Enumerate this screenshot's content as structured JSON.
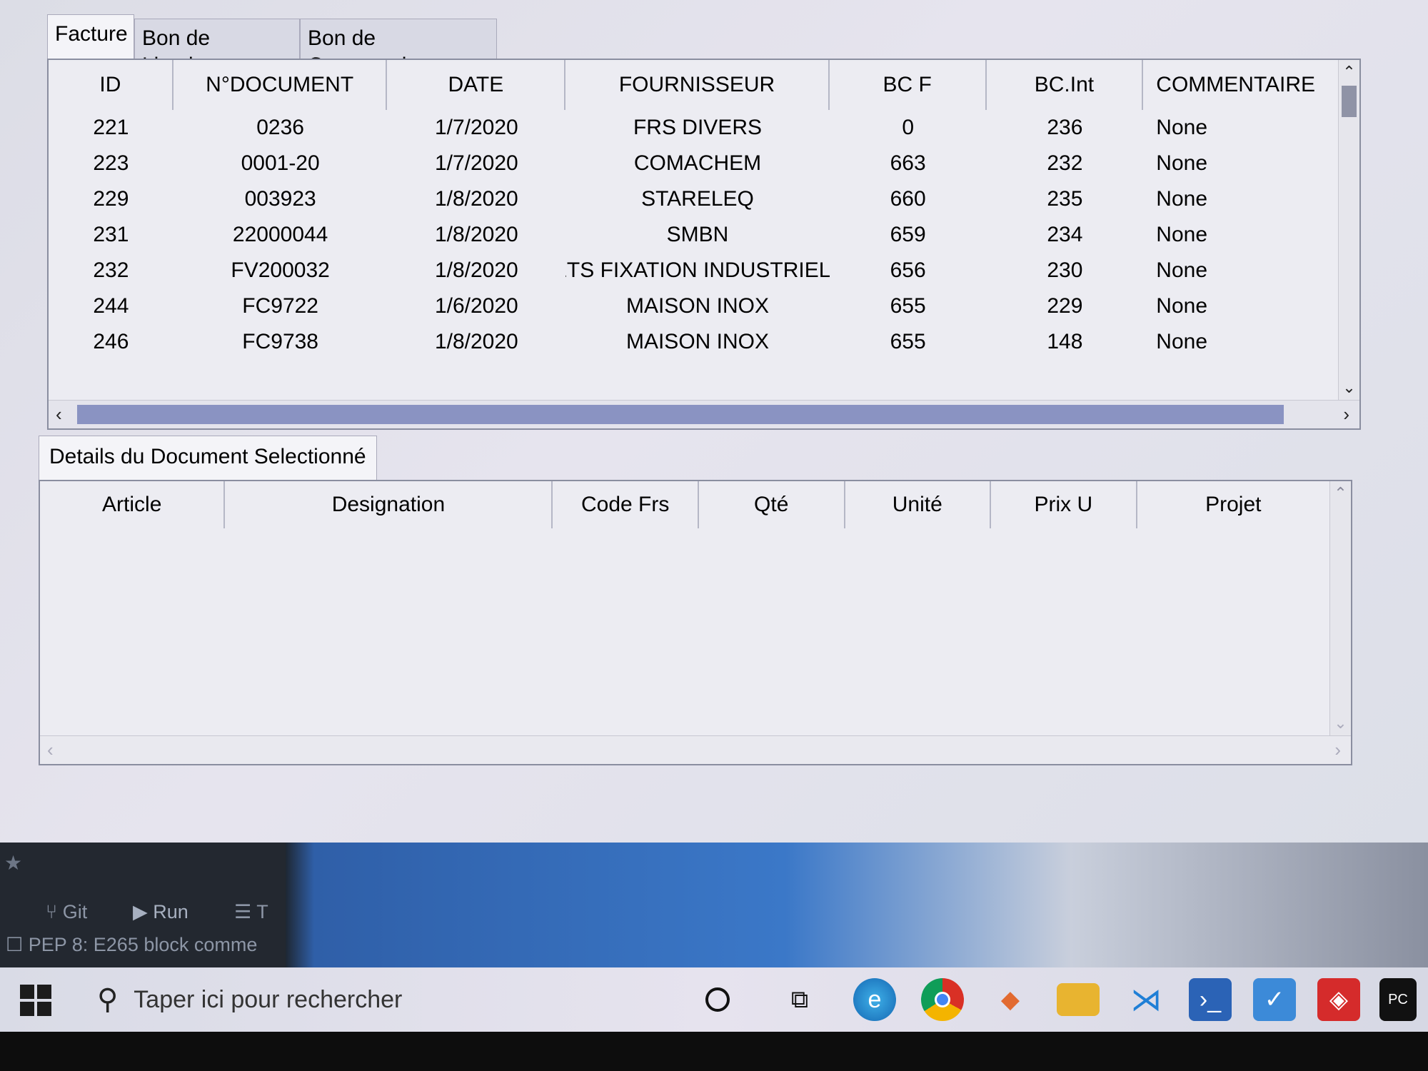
{
  "tabs": [
    "Facture",
    "Bon de Livraison",
    "Bon de Commande"
  ],
  "table": {
    "columns": [
      "ID",
      "N°DOCUMENT",
      "DATE",
      "FOURNISSEUR",
      "BC F",
      "BC.Int",
      "COMMENTAIRE"
    ],
    "rows": [
      [
        "221",
        "0236",
        "1/7/2020",
        "FRS DIVERS",
        "0",
        "236",
        "None"
      ],
      [
        "223",
        "0001-20",
        "1/7/2020",
        "COMACHEM",
        "663",
        "232",
        "None"
      ],
      [
        "229",
        "003923",
        "1/8/2020",
        "STARELEQ",
        "660",
        "235",
        "None"
      ],
      [
        "231",
        "22000044",
        "1/8/2020",
        "SMBN",
        "659",
        "234",
        "None"
      ],
      [
        "232",
        "FV200032",
        "1/8/2020",
        "ETS FIXATION INDUSTRIELL",
        "656",
        "230",
        "None"
      ],
      [
        "244",
        "FC9722",
        "1/6/2020",
        "MAISON INOX",
        "655",
        "229",
        "None"
      ],
      [
        "246",
        "FC9738",
        "1/8/2020",
        "MAISON INOX",
        "655",
        "148",
        "None"
      ]
    ]
  },
  "details": {
    "tab": "Details du Document Selectionné",
    "columns": [
      "Article",
      "Designation",
      "Code Frs",
      "Qté",
      "Unité",
      "Prix U",
      "Projet"
    ]
  },
  "ide": {
    "git": "Git",
    "run": "Run",
    "todo": "T",
    "status": "PEP 8: E265 block comme"
  },
  "taskbar": {
    "search_placeholder": "Taper ici pour rechercher",
    "pycharm_label": "PC"
  }
}
